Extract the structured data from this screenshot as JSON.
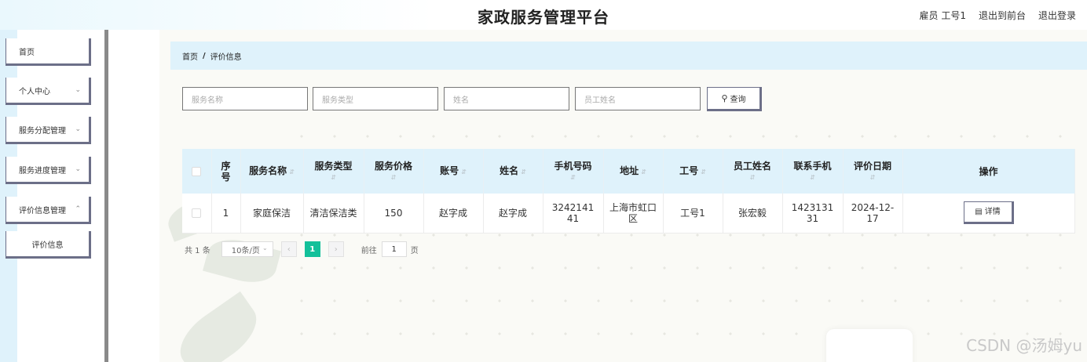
{
  "header": {
    "title": "家政服务管理平台",
    "user_label": "雇员 工号1",
    "front_link": "退出到前台",
    "logout_link": "退出登录"
  },
  "sidebar": {
    "items": [
      {
        "label": "首页"
      },
      {
        "label": "个人中心"
      },
      {
        "label": "服务分配管理"
      },
      {
        "label": "服务进度管理"
      },
      {
        "label": "评价信息管理"
      },
      {
        "label": "评价信息"
      }
    ]
  },
  "breadcrumb": {
    "home": "首页",
    "separator": "/",
    "current": "评价信息"
  },
  "search": {
    "service_name_placeholder": "服务名称",
    "service_type_placeholder": "服务类型",
    "name_placeholder": "姓名",
    "employee_name_placeholder": "员工姓名",
    "button_label": "查询"
  },
  "table": {
    "columns": {
      "seq": "序号",
      "service_name": "服务名称",
      "service_type": "服务类型",
      "service_price": "服务价格",
      "account": "账号",
      "name": "姓名",
      "phone": "手机号码",
      "address": "地址",
      "employee_no": "工号",
      "employee_name": "员工姓名",
      "contact_phone": "联系手机",
      "review_date": "评价日期",
      "action": "操作"
    },
    "rows": [
      {
        "seq": "1",
        "service_name": "家庭保洁",
        "service_type": "清洁保洁类",
        "service_price": "150",
        "account": "赵字成",
        "name": "赵字成",
        "phone": "324214141",
        "address": "上海市虹口区",
        "employee_no": "工号1",
        "employee_name": "张宏毅",
        "contact_phone": "142313131",
        "review_date": "2024-12-17",
        "detail_label": "详情"
      }
    ]
  },
  "pagination": {
    "total": "共 1 条",
    "page_size": "10条/页",
    "current_page": "1",
    "goto_label": "前往",
    "goto_value": "1",
    "page_unit": "页"
  },
  "watermark": "CSDN @汤姆yu",
  "colors": {
    "accent_light": "#dff2fb",
    "pager_active": "#13c09a",
    "button_border": "#6c6f88"
  }
}
